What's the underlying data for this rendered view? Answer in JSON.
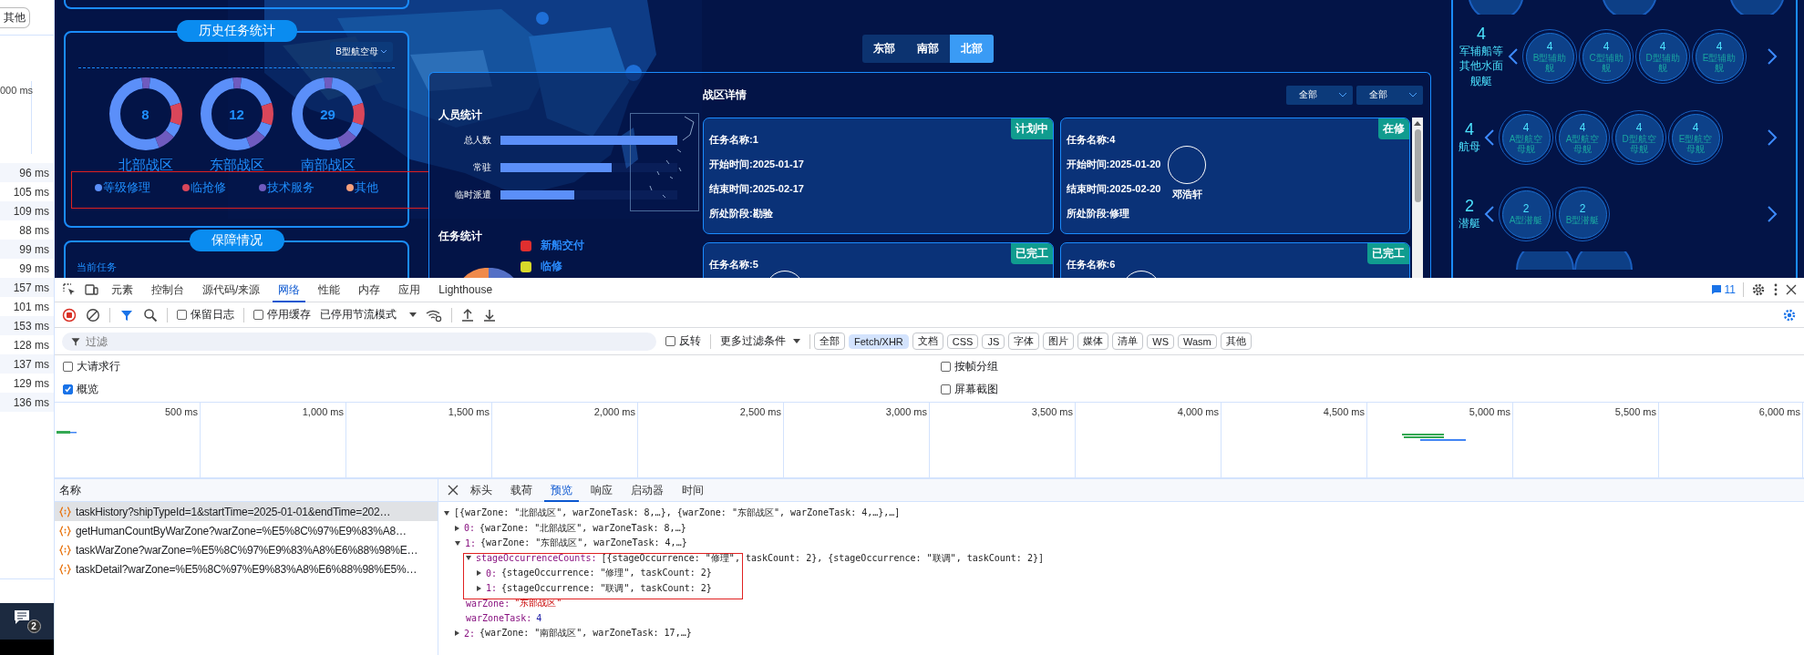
{
  "side_strip": {
    "filter_button": "其他",
    "timeline_label": "000 ms",
    "durations": [
      "96 ms",
      "105 ms",
      "109 ms",
      "88 ms",
      "99 ms",
      "99 ms",
      "157 ms",
      "101 ms",
      "153 ms",
      "128 ms",
      "137 ms",
      "129 ms",
      "136 ms"
    ],
    "notification_badge": "2"
  },
  "dashboard": {
    "history_panel": {
      "title": "历史任务统计",
      "ship_select": "B型航空母",
      "donuts": [
        {
          "total": "8",
          "label": "北部战区"
        },
        {
          "total": "12",
          "label": "东部战区"
        },
        {
          "total": "29",
          "label": "南部战区"
        }
      ],
      "legend": [
        {
          "label": "等级修理",
          "color": "#5b8ff9"
        },
        {
          "label": "临抢修",
          "color": "#d9465a"
        },
        {
          "label": "技术服务",
          "color": "#6f5bbf"
        },
        {
          "label": "其他",
          "color": "#f7a07c"
        }
      ]
    },
    "support_panel": {
      "title": "保障情况",
      "subtitle": "当前任务"
    },
    "zone_tabs": [
      {
        "label": "东部",
        "selected": false
      },
      {
        "label": "南部",
        "selected": false
      },
      {
        "label": "北部",
        "selected": true
      }
    ],
    "personnel": {
      "title": "人员统计",
      "bars": [
        {
          "label": "总人数",
          "level": 1
        },
        {
          "label": "常驻",
          "level": 0.63
        },
        {
          "label": "临时派遣",
          "level": 0.42
        }
      ]
    },
    "task_stats": {
      "title": "任务统计",
      "legend": [
        {
          "label": "新船交付",
          "color": "#e02f2f"
        },
        {
          "label": "临修",
          "color": "#d8d82a"
        }
      ]
    },
    "zone_detail": {
      "title": "战区详情",
      "filters": [
        "全部",
        "全部"
      ],
      "cards": [
        {
          "status": "计划中",
          "lines": [
            "任务名称:1",
            "开始时间:2025-01-17",
            "结束时间:2025-02-17",
            "所处阶段:勘验"
          ]
        },
        {
          "status": "在修",
          "lines": [
            "任务名称:4",
            "开始时间:2025-01-20",
            "结束时间:2025-02-20",
            "所处阶段:修理"
          ],
          "person": "邓浩轩"
        },
        {
          "status": "已完工",
          "lines": [
            "任务名称:5"
          ],
          "avatar": true
        },
        {
          "status": "已完工",
          "lines": [
            "任务名称:6"
          ],
          "avatar": true
        }
      ]
    },
    "ship_types": [
      {
        "count": "4",
        "name": "军辅船等其他水面舰艇",
        "items": [
          {
            "count": "4",
            "name": "B型辅助舰"
          },
          {
            "count": "4",
            "name": "C型辅助舰"
          },
          {
            "count": "4",
            "name": "D型辅助舰"
          },
          {
            "count": "4",
            "name": "E型辅助舰"
          }
        ]
      },
      {
        "count": "4",
        "name": "航母",
        "items": [
          {
            "count": "4",
            "name": "A型航空母舰"
          },
          {
            "count": "4",
            "name": "A型航空母舰"
          },
          {
            "count": "4",
            "name": "D型航空母舰"
          },
          {
            "count": "4",
            "name": "E型航空母舰"
          }
        ]
      },
      {
        "count": "2",
        "name": "潜艇",
        "items": [
          {
            "count": "2",
            "name": "A型潜艇"
          },
          {
            "count": "2",
            "name": "B型潜艇"
          }
        ]
      }
    ]
  },
  "devtools": {
    "panel_tabs": [
      {
        "label": "元素",
        "selected": false
      },
      {
        "label": "控制台",
        "selected": false
      },
      {
        "label": "源代码/来源",
        "selected": false
      },
      {
        "label": "网络",
        "selected": true
      },
      {
        "label": "性能",
        "selected": false
      },
      {
        "label": "内存",
        "selected": false
      },
      {
        "label": "应用",
        "selected": false
      },
      {
        "label": "Lighthouse",
        "selected": false
      }
    ],
    "issues_count": "11",
    "toolbar": {
      "preserve_log": {
        "label": "保留日志",
        "checked": false
      },
      "disable_cache": {
        "label": "停用缓存",
        "checked": false
      },
      "throttling": "已停用节流模式"
    },
    "filter": {
      "placeholder": "过滤",
      "invert": {
        "label": "反转",
        "checked": false
      },
      "more_filters": "更多过滤条件",
      "types": [
        {
          "label": "全部",
          "selected": false
        },
        {
          "label": "Fetch/XHR",
          "selected": true
        },
        {
          "label": "文档",
          "selected": false
        },
        {
          "label": "CSS",
          "selected": false
        },
        {
          "label": "JS",
          "selected": false
        },
        {
          "label": "字体",
          "selected": false
        },
        {
          "label": "图片",
          "selected": false
        },
        {
          "label": "媒体",
          "selected": false
        },
        {
          "label": "清单",
          "selected": false
        },
        {
          "label": "WS",
          "selected": false
        },
        {
          "label": "Wasm",
          "selected": false
        },
        {
          "label": "其他",
          "selected": false
        }
      ]
    },
    "options": [
      {
        "label": "大请求行",
        "checked": false
      },
      {
        "label": "按帧分组",
        "checked": false
      },
      {
        "label": "概览",
        "checked": true
      },
      {
        "label": "屏幕截图",
        "checked": false
      }
    ],
    "overview": {
      "ticks": [
        "500 ms",
        "1,000 ms",
        "1,500 ms",
        "2,000 ms",
        "2,500 ms",
        "3,000 ms",
        "3,500 ms",
        "4,000 ms",
        "4,500 ms",
        "5,000 ms",
        "5,500 ms",
        "6,000 ms"
      ]
    },
    "requests": {
      "header": "名称",
      "rows": [
        {
          "name": "taskHistory?shipTypeId=1&startTime=2025-01-01&endTime=202…",
          "selected": true
        },
        {
          "name": "getHumanCountByWarZone?warZone=%E5%8C%97%E9%83%A8…",
          "selected": false
        },
        {
          "name": "taskWarZone?warZone=%E5%8C%97%E9%83%A8%E6%88%98%E…",
          "selected": false
        },
        {
          "name": "taskDetail?warZone=%E5%8C%97%E9%83%A8%E6%88%98%E5%…",
          "selected": false
        }
      ]
    },
    "detail_tabs": [
      {
        "label": "标头",
        "selected": false
      },
      {
        "label": "载荷",
        "selected": false
      },
      {
        "label": "预览",
        "selected": true
      },
      {
        "label": "响应",
        "selected": false
      },
      {
        "label": "启动器",
        "selected": false
      },
      {
        "label": "时间",
        "selected": false
      }
    ],
    "preview": {
      "tree": [
        {
          "kind": "object",
          "summary": "[{warZone: \"北部战区\", warZoneTask: 8,…}, {warZone: \"东部战区\", warZoneTask: 4,…},…]",
          "expanded": true,
          "children": [
            {
              "kind": "object",
              "key": "0:",
              "summary": "{warZone: \"北部战区\", warZoneTask: 8,…}",
              "expanded": false
            },
            {
              "kind": "object",
              "key": "1:",
              "summary": "{warZone: \"东部战区\", warZoneTask: 4,…}",
              "expanded": true,
              "children": [
                {
                  "kind": "object",
                  "key": "stageOccurrenceCounts:",
                  "summary": "[{stageOccurrence: \"修理\", taskCount: 2}, {stageOccurrence: \"联调\", taskCount: 2}]",
                  "expanded": true,
                  "children": [
                    {
                      "kind": "object",
                      "key": "0:",
                      "summary": "{stageOccurrence: \"修理\", taskCount: 2}",
                      "expanded": false
                    },
                    {
                      "kind": "object",
                      "key": "1:",
                      "summary": "{stageOccurrence: \"联调\", taskCount: 2}",
                      "expanded": false
                    }
                  ]
                },
                {
                  "kind": "string",
                  "key": "warZone:",
                  "value": "\"东部战区\""
                },
                {
                  "kind": "number",
                  "key": "warZoneTask:",
                  "value": "4"
                }
              ]
            },
            {
              "kind": "object",
              "key": "2:",
              "summary": "{warZone: \"南部战区\", warZoneTask: 17,…}",
              "expanded": false
            }
          ]
        }
      ]
    }
  }
}
